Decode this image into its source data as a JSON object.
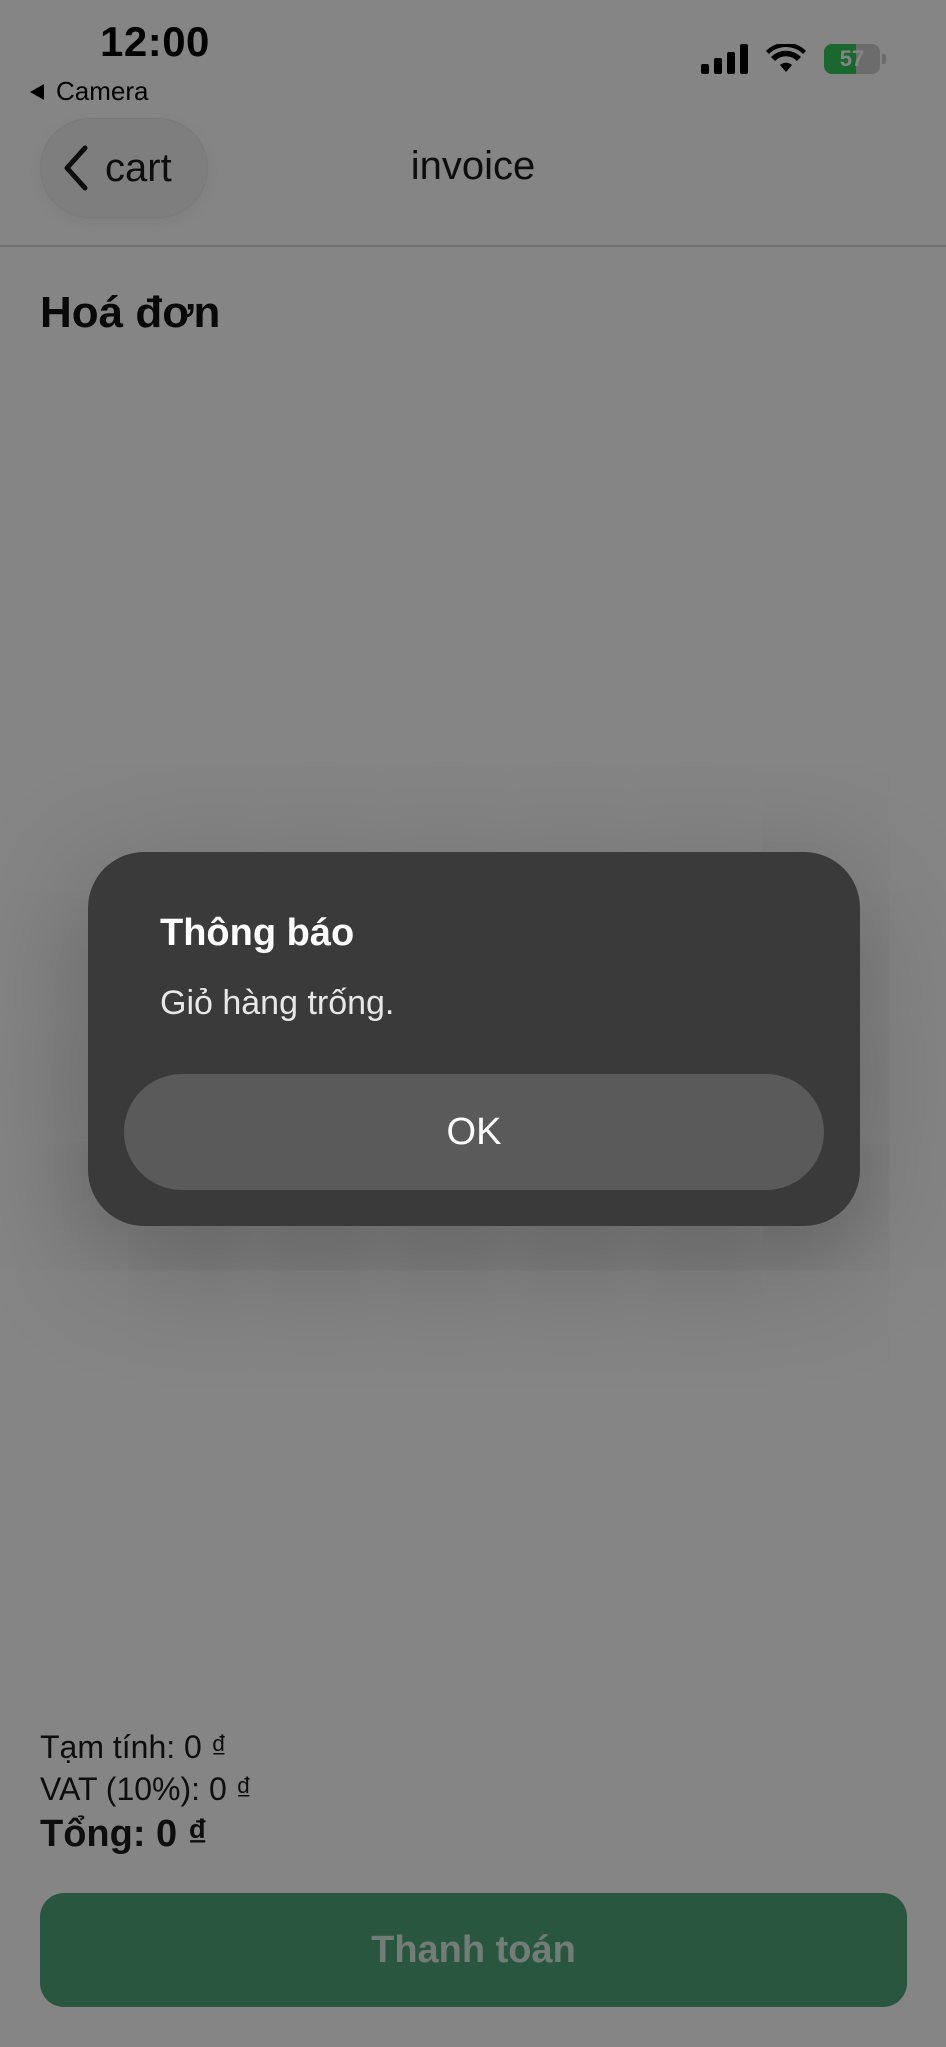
{
  "status_bar": {
    "time": "12:00",
    "back_app_label": "Camera",
    "battery_level": "57",
    "battery_color": "#34c759"
  },
  "nav": {
    "back_label": "cart",
    "title": "invoice"
  },
  "page": {
    "heading": "Hoá đơn"
  },
  "summary": {
    "subtotal": "Tạm tính: 0 ₫",
    "vat": "VAT (10%): 0 ₫",
    "total": "Tổng: 0 ₫"
  },
  "pay_button": {
    "label": "Thanh toán",
    "color": "#4fa57a"
  },
  "alert": {
    "title": "Thông báo",
    "message": "Giỏ hàng trống.",
    "ok_label": "OK"
  }
}
